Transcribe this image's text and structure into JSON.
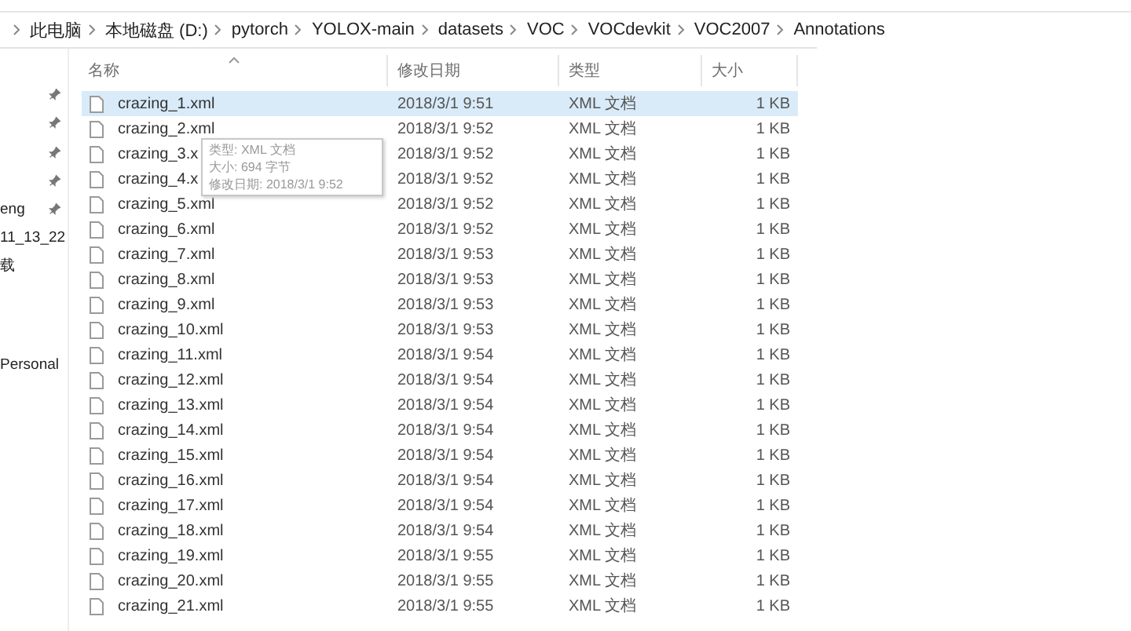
{
  "breadcrumb": [
    "此电脑",
    "本地磁盘 (D:)",
    "pytorch",
    "YOLOX-main",
    "datasets",
    "VOC",
    "VOCdevkit",
    "VOC2007",
    "Annotations"
  ],
  "nav_pane": {
    "quick_access": [
      {
        "pinned": true
      },
      {
        "pinned": true
      },
      {
        "pinned": true
      },
      {
        "pinned": true
      },
      {
        "label": "eng",
        "pinned": true
      },
      {
        "label": "11_13_22",
        "pinned": false
      },
      {
        "label": "载",
        "pinned": false
      }
    ],
    "other": [
      {
        "label": "Personal"
      }
    ]
  },
  "columns": [
    {
      "label": "名称",
      "sorted": true
    },
    {
      "label": "修改日期",
      "sorted": false
    },
    {
      "label": "类型",
      "sorted": false
    },
    {
      "label": "大小",
      "sorted": false
    }
  ],
  "rows": [
    {
      "name": "crazing_1.xml",
      "modified": "2018/3/1 9:51",
      "type": "XML 文档",
      "size": "1 KB",
      "selected": true
    },
    {
      "name": "crazing_2.xml",
      "modified": "2018/3/1 9:52",
      "type": "XML 文档",
      "size": "1 KB",
      "selected": false
    },
    {
      "name": "crazing_3.x",
      "modified": "2018/3/1 9:52",
      "type": "XML 文档",
      "size": "1 KB",
      "selected": false
    },
    {
      "name": "crazing_4.x",
      "modified": "2018/3/1 9:52",
      "type": "XML 文档",
      "size": "1 KB",
      "selected": false
    },
    {
      "name": "crazing_5.xml",
      "modified": "2018/3/1 9:52",
      "type": "XML 文档",
      "size": "1 KB",
      "selected": false
    },
    {
      "name": "crazing_6.xml",
      "modified": "2018/3/1 9:52",
      "type": "XML 文档",
      "size": "1 KB",
      "selected": false
    },
    {
      "name": "crazing_7.xml",
      "modified": "2018/3/1 9:53",
      "type": "XML 文档",
      "size": "1 KB",
      "selected": false
    },
    {
      "name": "crazing_8.xml",
      "modified": "2018/3/1 9:53",
      "type": "XML 文档",
      "size": "1 KB",
      "selected": false
    },
    {
      "name": "crazing_9.xml",
      "modified": "2018/3/1 9:53",
      "type": "XML 文档",
      "size": "1 KB",
      "selected": false
    },
    {
      "name": "crazing_10.xml",
      "modified": "2018/3/1 9:53",
      "type": "XML 文档",
      "size": "1 KB",
      "selected": false
    },
    {
      "name": "crazing_11.xml",
      "modified": "2018/3/1 9:54",
      "type": "XML 文档",
      "size": "1 KB",
      "selected": false
    },
    {
      "name": "crazing_12.xml",
      "modified": "2018/3/1 9:54",
      "type": "XML 文档",
      "size": "1 KB",
      "selected": false
    },
    {
      "name": "crazing_13.xml",
      "modified": "2018/3/1 9:54",
      "type": "XML 文档",
      "size": "1 KB",
      "selected": false
    },
    {
      "name": "crazing_14.xml",
      "modified": "2018/3/1 9:54",
      "type": "XML 文档",
      "size": "1 KB",
      "selected": false
    },
    {
      "name": "crazing_15.xml",
      "modified": "2018/3/1 9:54",
      "type": "XML 文档",
      "size": "1 KB",
      "selected": false
    },
    {
      "name": "crazing_16.xml",
      "modified": "2018/3/1 9:54",
      "type": "XML 文档",
      "size": "1 KB",
      "selected": false
    },
    {
      "name": "crazing_17.xml",
      "modified": "2018/3/1 9:54",
      "type": "XML 文档",
      "size": "1 KB",
      "selected": false
    },
    {
      "name": "crazing_18.xml",
      "modified": "2018/3/1 9:54",
      "type": "XML 文档",
      "size": "1 KB",
      "selected": false
    },
    {
      "name": "crazing_19.xml",
      "modified": "2018/3/1 9:55",
      "type": "XML 文档",
      "size": "1 KB",
      "selected": false
    },
    {
      "name": "crazing_20.xml",
      "modified": "2018/3/1 9:55",
      "type": "XML 文档",
      "size": "1 KB",
      "selected": false
    },
    {
      "name": "crazing_21.xml",
      "modified": "2018/3/1 9:55",
      "type": "XML 文档",
      "size": "1 KB",
      "selected": false
    }
  ],
  "tooltip": [
    "类型: XML 文档",
    "大小: 694 字节",
    "修改日期: 2018/3/1 9:52"
  ]
}
